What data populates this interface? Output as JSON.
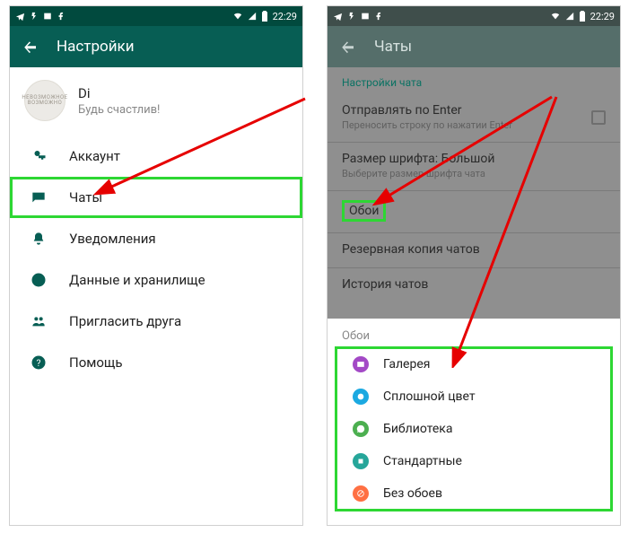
{
  "status": {
    "time": "22:29",
    "icons_left": [
      "telegram",
      "flash",
      "image",
      "facebook"
    ],
    "icons_right": [
      "wifi",
      "signal",
      "battery"
    ]
  },
  "left": {
    "appbar_title": "Настройки",
    "profile": {
      "name": "Di",
      "status": "Будь счастлив!",
      "avatar_line1": "НЕВОЗМОЖНОЕ",
      "avatar_line2": "ВОЗМОЖНО"
    },
    "menu": [
      {
        "icon": "key",
        "label": "Аккаунт"
      },
      {
        "icon": "chat",
        "label": "Чаты"
      },
      {
        "icon": "bell",
        "label": "Уведомления"
      },
      {
        "icon": "data",
        "label": "Данные и хранилище"
      },
      {
        "icon": "people",
        "label": "Пригласить друга"
      },
      {
        "icon": "help",
        "label": "Помощь"
      }
    ]
  },
  "right": {
    "appbar_title": "Чаты",
    "section": "Настройки чата",
    "rows": {
      "enter": {
        "title": "Отправлять по Enter",
        "sub": "Переносить строку по нажатии Enter"
      },
      "font": {
        "title": "Размер шрифта: Большой",
        "sub": "Выберите размер шрифта чата"
      },
      "wall": {
        "title": "Обои"
      },
      "backup": {
        "title": "Резервная копия чатов",
        "sub": ""
      },
      "history": {
        "title": "История чатов"
      }
    },
    "sheet": {
      "title": "Обои",
      "items": [
        {
          "color": "purple",
          "label": "Галерея"
        },
        {
          "color": "blue",
          "label": "Сплошной цвет"
        },
        {
          "color": "green",
          "label": "Библиотека"
        },
        {
          "color": "teal",
          "label": "Стандартные"
        },
        {
          "color": "orange",
          "label": "Без обоев"
        }
      ]
    }
  },
  "annot": {
    "highlight_menu_index": 1,
    "highlight_row": "wall",
    "highlight_sheet": true
  }
}
